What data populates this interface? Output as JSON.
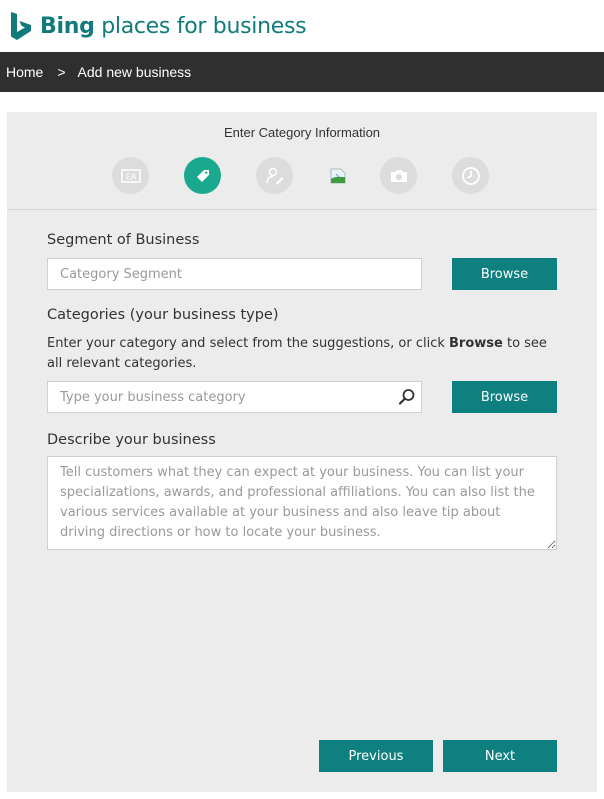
{
  "header": {
    "brand_bold": "Bing",
    "brand_rest": " places for business",
    "brand_color": "#117b7b"
  },
  "breadcrumb": {
    "home": "Home",
    "separator": ">",
    "current": "Add new business"
  },
  "wizard": {
    "title": "Enter Category Information",
    "active_color": "#1aa98f",
    "steps": [
      {
        "icon": "business-card-icon",
        "state": "inactive"
      },
      {
        "icon": "tag-icon",
        "state": "active"
      },
      {
        "icon": "contact-edit-icon",
        "state": "inactive"
      },
      {
        "icon": "broken-image-icon",
        "state": "inactive"
      },
      {
        "icon": "camera-icon",
        "state": "inactive"
      },
      {
        "icon": "clock-icon",
        "state": "inactive"
      }
    ]
  },
  "form": {
    "segment": {
      "label": "Segment of Business",
      "placeholder": "Category Segment",
      "value": "",
      "browse_label": "Browse"
    },
    "categories": {
      "label": "Categories (your business type)",
      "help_before": "Enter your category and select from the suggestions, or click ",
      "help_bold": "Browse",
      "help_after": " to see all relevant categories.",
      "placeholder": "Type your business category",
      "value": "",
      "browse_label": "Browse"
    },
    "description": {
      "label": "Describe your business",
      "placeholder": "Tell customers what they can expect at your business. You can list your specializations, awards, and professional affiliations. You can also list the various services available at your business and also leave tip about driving directions or how to locate your business.",
      "value": ""
    }
  },
  "nav": {
    "previous_label": "Previous",
    "next_label": "Next",
    "button_color": "#0f8080"
  }
}
